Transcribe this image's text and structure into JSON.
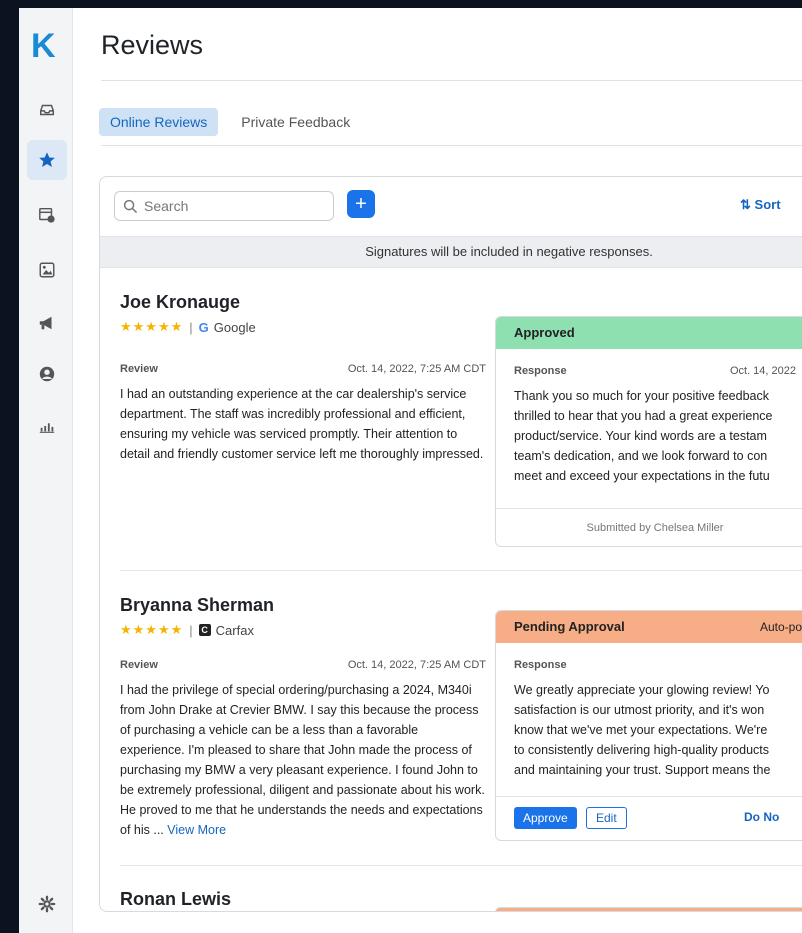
{
  "app": {
    "logo": "K",
    "title": "Reviews"
  },
  "sidebar": {
    "items": [
      {
        "name": "inbox-icon"
      },
      {
        "name": "star-icon",
        "active": true
      },
      {
        "name": "billing-icon"
      },
      {
        "name": "gallery-icon"
      },
      {
        "name": "megaphone-icon"
      },
      {
        "name": "user-icon"
      },
      {
        "name": "analytics-icon"
      }
    ],
    "settings_icon": "gear-icon"
  },
  "tabs": [
    {
      "label": "Online Reviews",
      "active": true
    },
    {
      "label": "Private Feedback",
      "active": false
    }
  ],
  "toolbar": {
    "search_placeholder": "Search",
    "add_label": "+",
    "sort_label": "Sort"
  },
  "banner": "Signatures will be included in negative responses.",
  "reviews": [
    {
      "name": "Joe Kronauge",
      "stars": "★★★★★",
      "source_icon": "G",
      "source": "Google",
      "review_label": "Review",
      "date": "Oct. 14, 2022, 7:25 AM CDT",
      "text": "I had an outstanding experience at the car dealership's service department. The staff was incredibly professional and efficient, ensuring my vehicle was serviced promptly. Their attention to detail and friendly customer service left me thoroughly impressed.",
      "response": {
        "status": "Approved",
        "label": "Response",
        "date": "Oct. 14, 2022",
        "lines": [
          "Thank you so much for your positive feedback",
          "thrilled to hear that you had a great experience",
          "product/service. Your kind words are a testam",
          "team's dedication, and we look forward to con",
          "meet and exceed your expectations in the futu"
        ],
        "footer": "Submitted by Chelsea Miller"
      }
    },
    {
      "name": "Bryanna Sherman",
      "stars": "★★★★★",
      "source_icon": "C",
      "source": "Carfax",
      "review_label": "Review",
      "date": "Oct. 14, 2022, 7:25 AM CDT",
      "text": "I had the privilege of special ordering/purchasing a 2024, M340i from John Drake at Crevier BMW. I say this because the process of purchasing a vehicle can be a less than a favorable experience. I'm pleased to share that John made the process of purchasing my BMW a very pleasant experience. I found John to be extremely professional, diligent and passionate about his work. He proved to me that he understands the needs and expectations of his ...",
      "view_more": "View More",
      "response": {
        "status": "Pending Approval",
        "auto": "Auto-po",
        "label": "Response",
        "lines": [
          "We greatly appreciate your glowing review! Yo",
          "satisfaction is our utmost priority, and it's won",
          "know that we've met your expectations. We're",
          "to consistently delivering high-quality products",
          "and maintaining your trust. Support means the"
        ],
        "approve": "Approve",
        "edit": "Edit",
        "do_not_post": "Do No"
      }
    },
    {
      "name": "Ronan Lewis"
    }
  ]
}
